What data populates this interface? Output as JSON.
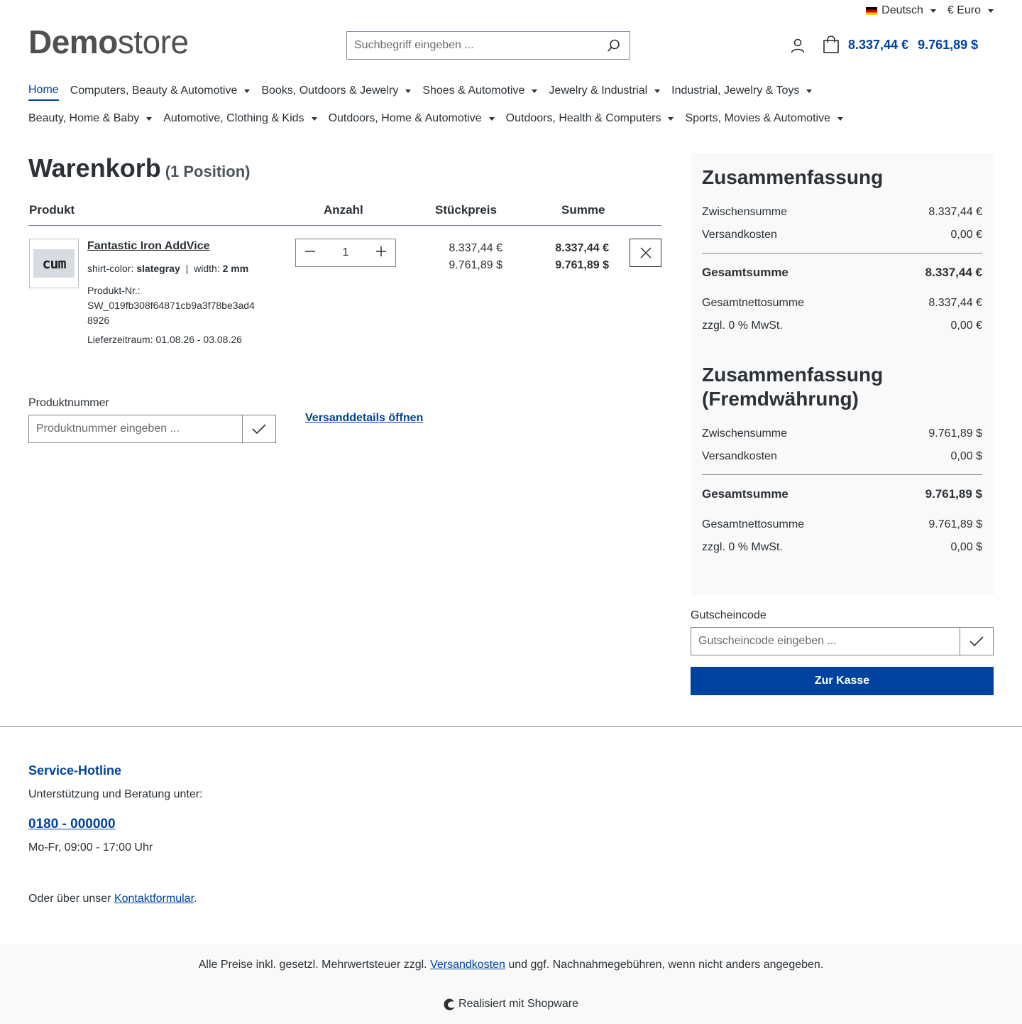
{
  "topbar": {
    "language": "Deutsch",
    "currency": "€ Euro"
  },
  "header": {
    "logo_bold": "Demo",
    "logo_light": "store",
    "search_placeholder": "Suchbegriff eingeben ...",
    "cart_total_eur": "8.337,44 €",
    "cart_total_usd": "9.761,89 $"
  },
  "nav": {
    "row1": [
      "Home",
      "Computers, Beauty & Automotive",
      "Books, Outdoors & Jewelry",
      "Shoes & Automotive",
      "Jewelry & Industrial",
      "Industrial, Jewelry & Toys"
    ],
    "row2": [
      "Beauty, Home & Baby",
      "Automotive, Clothing & Kids",
      "Outdoors, Home & Automotive",
      "Outdoors, Health & Computers",
      "Sports, Movies & Automotive"
    ]
  },
  "cart": {
    "title": "Warenkorb",
    "count": "(1 Position)",
    "headers": {
      "product": "Produkt",
      "quantity": "Anzahl",
      "unit_price": "Stückpreis",
      "sum": "Summe"
    },
    "item": {
      "thumb_text": "cum",
      "name": "Fantastic Iron AddVice",
      "variant1_label": "shirt-color:",
      "variant1_value": "slategray",
      "variant2_label": "width:",
      "variant2_value": "2 mm",
      "number_label": "Produkt-Nr.:",
      "number": "SW_019fb308f64871cb9a3f78be3ad48926",
      "delivery": "Lieferzeitraum: 01.08.26 - 03.08.26",
      "quantity": "1",
      "unit_price_eur": "8.337,44 €",
      "unit_price_usd": "9.761,89 $",
      "sum_eur": "8.337,44 €",
      "sum_usd": "9.761,89 $"
    },
    "product_number_label": "Produktnummer",
    "product_number_placeholder": "Produktnummer eingeben ...",
    "shipping_link": "Versanddetails öffnen"
  },
  "summary": {
    "title": "Zusammenfassung",
    "subtotal_label": "Zwischensumme",
    "subtotal": "8.337,44 €",
    "shipping_label": "Versandkosten",
    "shipping": "0,00 €",
    "total_label": "Gesamtsumme",
    "total": "8.337,44 €",
    "net_label": "Gesamtnettosumme",
    "net": "8.337,44 €",
    "tax_label": "zzgl. 0 % MwSt.",
    "tax": "0,00 €"
  },
  "summary_foreign": {
    "title": "Zusammenfassung (Fremdwährung)",
    "subtotal_label": "Zwischensumme",
    "subtotal": "9.761,89 $",
    "shipping_label": "Versandkosten",
    "shipping": "0,00 $",
    "total_label": "Gesamtsumme",
    "total": "9.761,89 $",
    "net_label": "Gesamtnettosumme",
    "net": "9.761,89 $",
    "tax_label": "zzgl. 0 % MwSt.",
    "tax": "0,00 $"
  },
  "voucher": {
    "label": "Gutscheincode",
    "placeholder": "Gutscheincode eingeben ..."
  },
  "checkout_label": "Zur Kasse",
  "footer": {
    "hotline_title": "Service-Hotline",
    "hotline_sub": "Unterstützung und Beratung unter:",
    "hotline_number": "0180 - 000000",
    "hotline_hours": "Mo-Fr, 09:00 - 17:00 Uhr",
    "contact_prefix": "Oder über unser ",
    "contact_link": "Kontaktformular",
    "contact_suffix": ".",
    "vat_prefix": "Alle Preise inkl. gesetzl. Mehrwertsteuer zzgl. ",
    "vat_link": "Versandkosten",
    "vat_suffix": " und ggf. Nachnahmegebühren, wenn nicht anders angegeben.",
    "powered": "Realisiert mit Shopware"
  },
  "colors": {
    "accent": "#0042a0",
    "text": "#2b3136",
    "panel": "#f9f9f9"
  }
}
